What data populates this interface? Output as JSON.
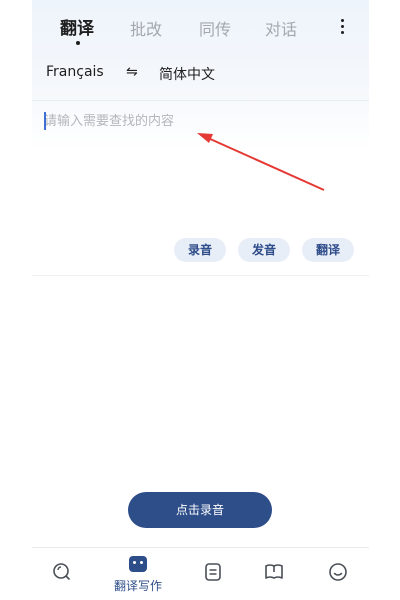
{
  "tabs": [
    {
      "label": "翻译",
      "active": true
    },
    {
      "label": "批改",
      "active": false
    },
    {
      "label": "同传",
      "active": false
    },
    {
      "label": "对话",
      "active": false
    }
  ],
  "languages": {
    "source": "Français",
    "swap_symbol": "⇋",
    "target": "简体中文"
  },
  "input": {
    "placeholder": "请输入需要查找的内容",
    "value": ""
  },
  "actions": {
    "record_label": "录音",
    "pronounce_label": "发音",
    "translate_label": "翻译"
  },
  "record_button": {
    "label": "点击录音"
  },
  "bottom_nav": {
    "items": [
      {
        "icon": "search-icon",
        "label": ""
      },
      {
        "icon": "robot-icon",
        "label": "翻译写作",
        "active": true
      },
      {
        "icon": "notes-icon",
        "label": ""
      },
      {
        "icon": "book-icon",
        "label": ""
      },
      {
        "icon": "smiley-icon",
        "label": ""
      }
    ]
  },
  "colors": {
    "accent": "#2e4e8a",
    "pill_bg": "#e8eef7",
    "annotation_arrow": "#e53935"
  }
}
